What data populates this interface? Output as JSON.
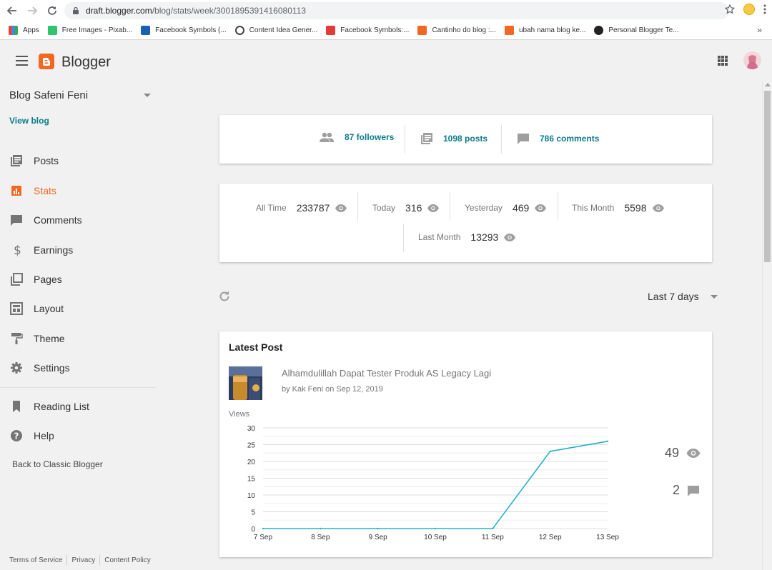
{
  "browser": {
    "url_host": "draft.blogger.com",
    "url_path": "/blog/stats/week/3001895391416080113",
    "bookmarks": [
      {
        "label": "Apps",
        "icon": "apps-grid-icon",
        "color": "#e94235"
      },
      {
        "label": "Free Images - Pixab...",
        "icon": "pixabay-icon",
        "color": "#2ec66d"
      },
      {
        "label": "Facebook Symbols (...",
        "icon": "heart-icon",
        "color": "#1a5fb4"
      },
      {
        "label": "Content Idea Gener...",
        "icon": "ring-icon",
        "color": "#444444"
      },
      {
        "label": "Facebook Symbols:...",
        "icon": "flash-icon",
        "color": "#e43a3a"
      },
      {
        "label": "Cantinho do blog :...",
        "icon": "blogger-icon",
        "color": "#f26722"
      },
      {
        "label": "ubah nama blog ke...",
        "icon": "blogger-icon",
        "color": "#f26722"
      },
      {
        "label": "Personal Blogger Te...",
        "icon": "dark-circle-icon",
        "color": "#222222"
      }
    ],
    "more": "»"
  },
  "header": {
    "brand": "Blogger",
    "brand_color": "#f26722"
  },
  "sidebar": {
    "blog_name": "Blog Safeni Feni",
    "view_blog": "View blog",
    "items": [
      {
        "label": "Posts",
        "icon": "posts-icon"
      },
      {
        "label": "Stats",
        "icon": "stats-icon"
      },
      {
        "label": "Comments",
        "icon": "comment-icon"
      },
      {
        "label": "Earnings",
        "icon": "dollar-icon"
      },
      {
        "label": "Pages",
        "icon": "pages-icon"
      },
      {
        "label": "Layout",
        "icon": "layout-icon"
      },
      {
        "label": "Theme",
        "icon": "paint-roller-icon"
      },
      {
        "label": "Settings",
        "icon": "gear-icon"
      },
      {
        "label": "Reading List",
        "icon": "bookmark-icon"
      },
      {
        "label": "Help",
        "icon": "help-icon"
      }
    ],
    "active": "Stats",
    "back_classic": "Back to Classic Blogger",
    "footer": [
      "Terms of Service",
      "Privacy",
      "Content Policy"
    ]
  },
  "summary": {
    "followers": "87 followers",
    "posts": "1098 posts",
    "comments": "786 comments"
  },
  "stats": {
    "all_time_label": "All Time",
    "all_time_value": "233787",
    "today_label": "Today",
    "today_value": "316",
    "yesterday_label": "Yesterday",
    "yesterday_value": "469",
    "this_month_label": "This Month",
    "this_month_value": "5598",
    "last_month_label": "Last Month",
    "last_month_value": "13293"
  },
  "range": "Last 7 days",
  "latest": {
    "heading": "Latest Post",
    "post_title": "Alhamdulillah Dapat Tester Produk AS Legacy Lagi",
    "post_meta": "by Kak Feni on Sep 12, 2019",
    "views_label": "Views",
    "views_total": "49",
    "comments_total": "2"
  },
  "chart_data": {
    "type": "line",
    "categories": [
      "7 Sep",
      "8 Sep",
      "9 Sep",
      "10 Sep",
      "11 Sep",
      "12 Sep",
      "13 Sep"
    ],
    "series": [
      {
        "values": [
          0,
          0,
          0,
          0,
          0,
          23,
          26
        ]
      }
    ],
    "ylim": [
      0,
      30
    ],
    "yticks": [
      0,
      5,
      10,
      15,
      20,
      25,
      30
    ],
    "ylabel": "Views",
    "grid": true,
    "line_color": "#26b3c8"
  }
}
